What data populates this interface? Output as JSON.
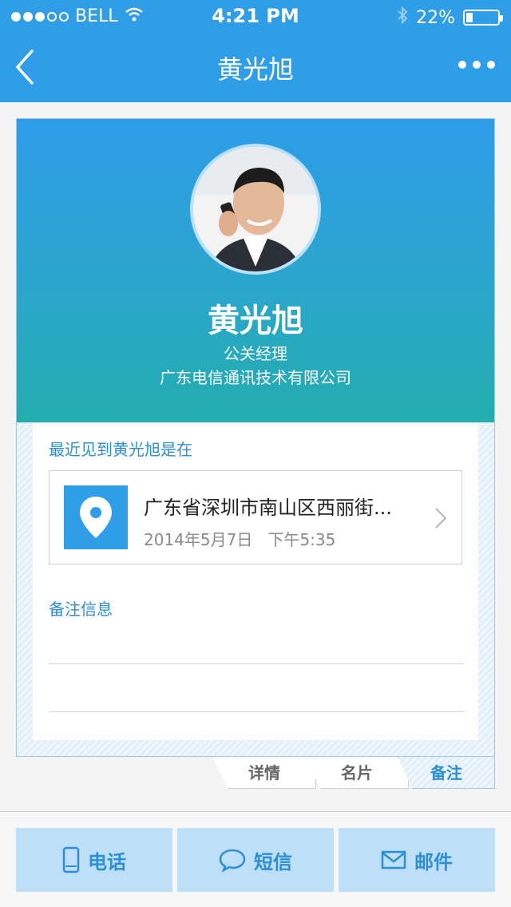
{
  "status_bar": {
    "carrier": "BELL",
    "signal_bars_filled": 3,
    "signal_bars_total": 5,
    "time": "4:21 PM",
    "battery_text": "22%",
    "battery_level": 0.22,
    "icons": [
      "wifi-icon",
      "bluetooth-icon",
      "battery-icon"
    ]
  },
  "nav": {
    "title": "黄光旭",
    "back_icon": "chevron-left-icon",
    "more_icon": "more-horizontal-icon"
  },
  "profile": {
    "name": "黄光旭",
    "role": "公关经理",
    "company": "广东电信通讯技术有限公司"
  },
  "last_seen": {
    "label": "最近见到黄光旭是在",
    "address": "广东省深圳市南山区西丽街...",
    "date": "2014年5月7日",
    "time": "下午5:35",
    "icon": "location-pin-icon"
  },
  "notes": {
    "label": "备注信息"
  },
  "tabs": [
    {
      "label": "详情",
      "active": false
    },
    {
      "label": "名片",
      "active": false
    },
    {
      "label": "备注",
      "active": true
    }
  ],
  "actions": [
    {
      "label": "电话",
      "icon": "phone-icon"
    },
    {
      "label": "短信",
      "icon": "message-bubble-icon"
    },
    {
      "label": "邮件",
      "icon": "mail-icon"
    }
  ],
  "colors": {
    "primary": "#2f9de8",
    "gradient_end": "#22adae",
    "accent_text": "#2c8fd6",
    "action_bg": "#bde0f8"
  }
}
